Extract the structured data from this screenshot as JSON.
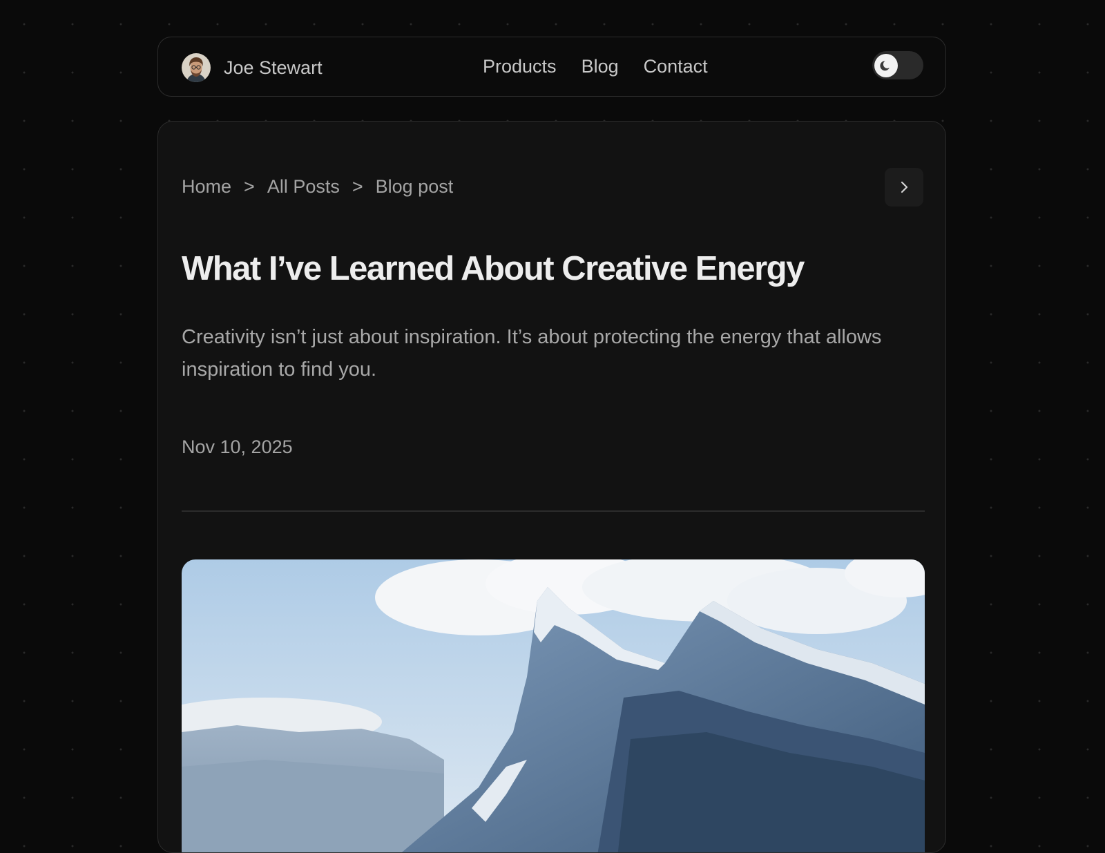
{
  "header": {
    "author_name": "Joe Stewart",
    "avatar_icon": "avatar-icon",
    "nav": [
      "Products",
      "Blog",
      "Contact"
    ],
    "theme_toggle": {
      "icon": "moon-icon",
      "state": "dark"
    }
  },
  "breadcrumb": [
    "Home",
    "All Posts",
    "Blog post"
  ],
  "breadcrumb_separator": ">",
  "next_button_icon": "chevron-right-icon",
  "post": {
    "title": "What I’ve Learned About Creative Energy",
    "excerpt": "Creativity isn’t just about inspiration. It’s about protecting the energy that allows inspiration to find you.",
    "date": "Nov 10, 2025",
    "hero_image_icon": "mountain-photo"
  },
  "colors": {
    "page_background": "#0a0a0a",
    "card_background": "#121212",
    "border": "#2c2c2c",
    "title_text": "#ededed",
    "secondary_text": "#a4a4a4"
  }
}
